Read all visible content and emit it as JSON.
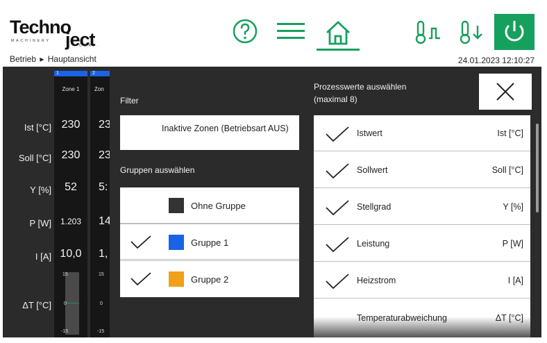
{
  "header": {
    "logo": {
      "part1": "Techno",
      "part2": "ject",
      "sub1": "MACHINERY",
      "sub2": "CORP."
    },
    "breadcrumb": {
      "item1": "Betrieb",
      "separator": "▸",
      "item2": "Hauptansicht"
    },
    "datetime": "24.01.2023 12:10:27",
    "accent_color": "#16a05d",
    "icons": [
      "help-icon",
      "menu-icon",
      "home-icon",
      "temperature-up-icon",
      "temperature-down-icon",
      "power-icon"
    ]
  },
  "readout": {
    "row_labels": [
      "Ist [°C]",
      "Soll [°C]",
      "Y [%]",
      "P [W]",
      "I [A]",
      "ΔT [°C]"
    ],
    "zones": [
      {
        "tab": "1",
        "name": "Zone 1",
        "ist": "230",
        "soll": "230",
        "y": "52",
        "p": "1.203",
        "i": "10,0",
        "dt_max": "15",
        "dt_zero": "0",
        "dt_min": "-15"
      },
      {
        "tab": "2",
        "name": "Zon",
        "ist": "23",
        "soll": "23",
        "y": "5:",
        "p": "14",
        "i": "1,",
        "dt_max": "15",
        "dt_zero": "0",
        "dt_min": "-15"
      }
    ]
  },
  "filter": {
    "title": "Filter",
    "inactive_button": "Inaktive Zonen (Betriebsart AUS)",
    "groups_title": "Gruppen auswählen",
    "groups": [
      {
        "label": "Ohne Gruppe",
        "checked": false,
        "color": "#333333"
      },
      {
        "label": "Gruppe 1",
        "checked": true,
        "color": "#1a63e6"
      },
      {
        "label": "Gruppe 2",
        "checked": true,
        "color": "#f0a01a"
      }
    ],
    "process_title_line1": "Prozesswerte auswählen",
    "process_title_line2": "(maximal 8)",
    "process_values": [
      {
        "label": "Istwert",
        "unit": "Ist [°C]",
        "checked": true
      },
      {
        "label": "Sollwert",
        "unit": "Soll [°C]",
        "checked": true
      },
      {
        "label": "Stellgrad",
        "unit": "Y [%]",
        "checked": true
      },
      {
        "label": "Leistung",
        "unit": "P [W]",
        "checked": true
      },
      {
        "label": "Heizstrom",
        "unit": "I [A]",
        "checked": true
      },
      {
        "label": "Temperaturabweichung",
        "unit": "ΔT [°C]",
        "checked": false
      }
    ]
  }
}
